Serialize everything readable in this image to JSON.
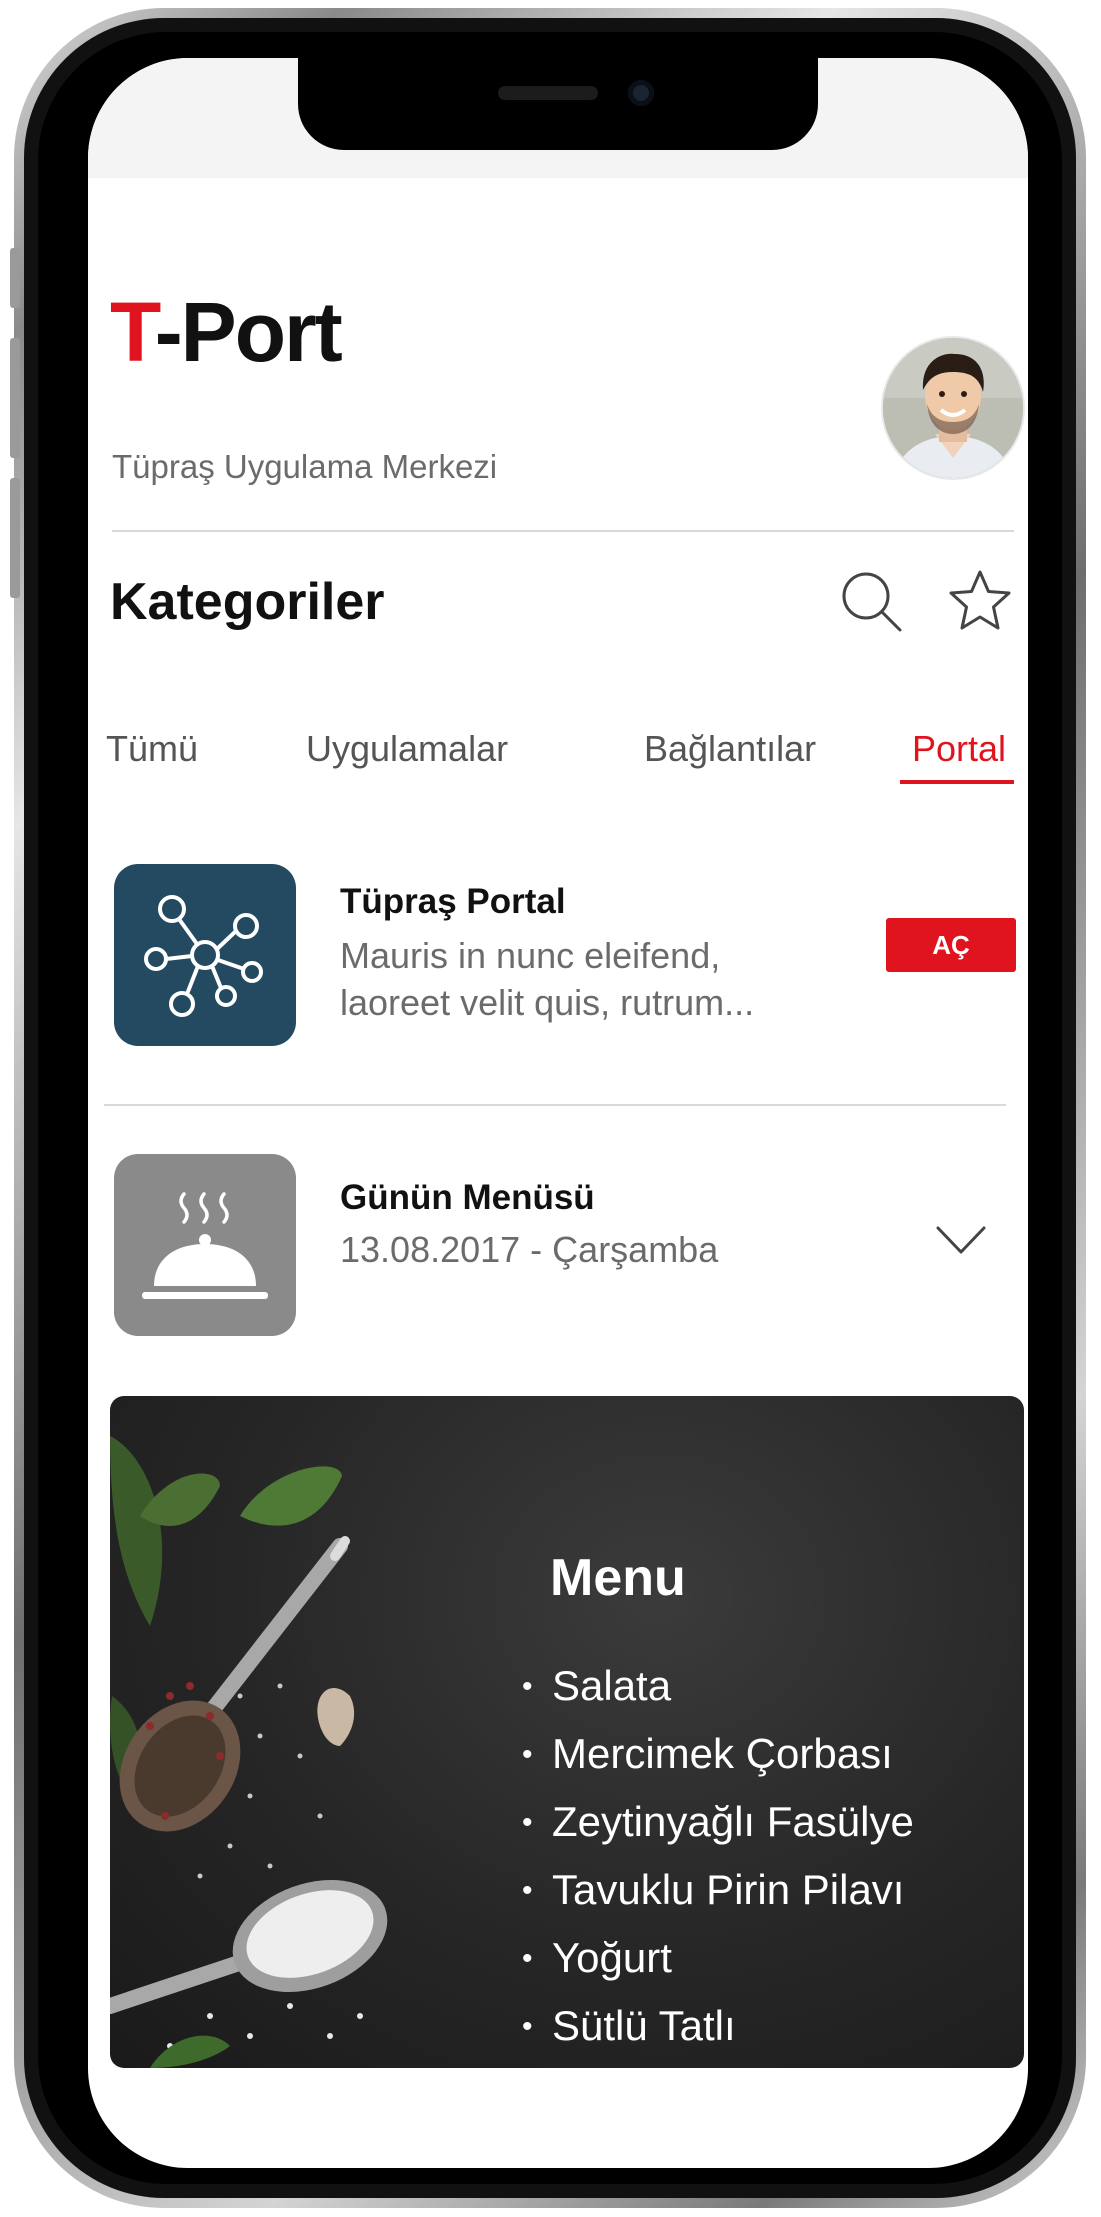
{
  "app": {
    "brand_prefix": "T",
    "brand_suffix": "-Port",
    "subtitle": "Tüpraş Uygulama Merkezi",
    "accent_color": "#e0141e"
  },
  "header": {
    "section_title": "Kategoriler",
    "search_icon": "search-icon",
    "favorites_icon": "star-icon"
  },
  "tabs": [
    {
      "label": "Tümü",
      "active": false
    },
    {
      "label": "Uygulamalar",
      "active": false
    },
    {
      "label": "Bağlantılar",
      "active": false
    },
    {
      "label": "Portal",
      "active": true
    }
  ],
  "items": [
    {
      "title": "Tüpraş Portal",
      "description_line1": "Mauris in nunc eleifend,",
      "description_line2": "laoreet velit quis, rutrum...",
      "action_label": "AÇ",
      "icon": "network-icon",
      "icon_color": "#234a60"
    },
    {
      "title": "Günün Menüsü",
      "subtitle": "13.08.2017 - Çarşamba",
      "icon": "cloche-icon",
      "icon_color": "#8a8a8a",
      "expand_icon": "chevron-down-icon"
    }
  ],
  "menu": {
    "title": "Menu",
    "items": [
      "Salata",
      "Mercimek Çorbası",
      "Zeytinyağlı Fasülye",
      "Tavuklu Pirin Pilavı",
      "Yoğurt",
      "Sütlü Tatlı"
    ]
  }
}
